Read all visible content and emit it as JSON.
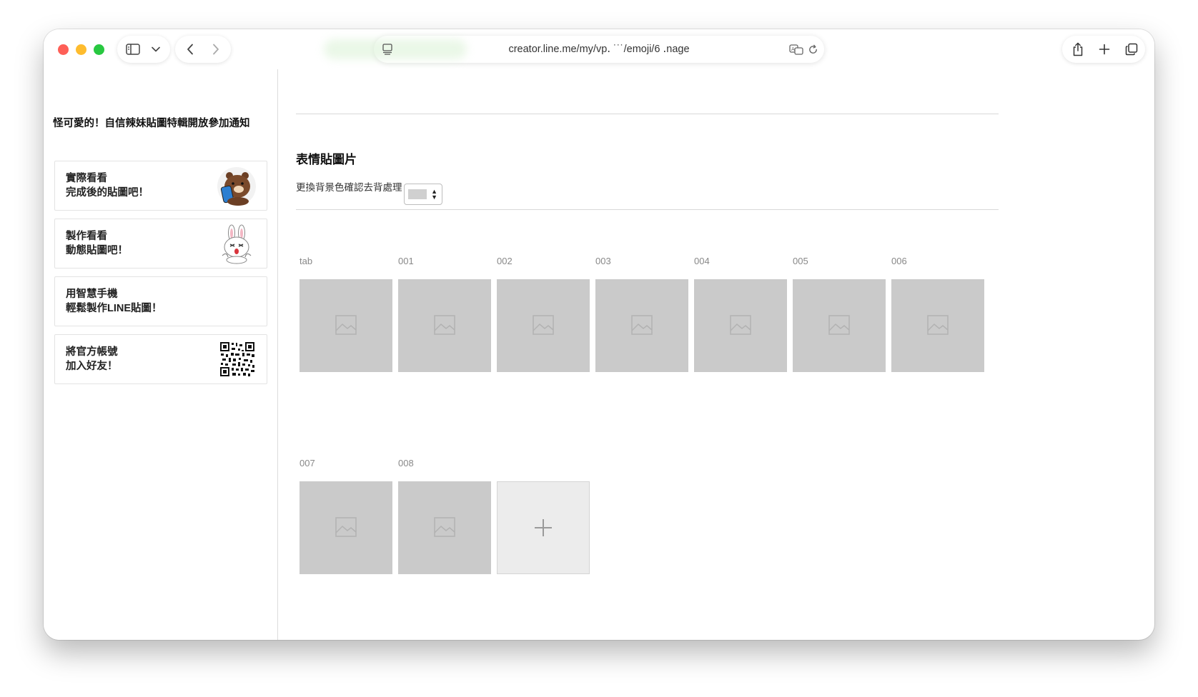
{
  "browser": {
    "url": "creator.line.me/my/vp․       ˙˙˙/emoji/6       ․nage"
  },
  "sidebar": {
    "title": "怪可愛的！自信辣妹貼圖特輯開放參加通知",
    "cards": [
      {
        "line1": "實際看看",
        "line2": "完成後的貼圖吧！",
        "icon": "brown-bear-phone-icon"
      },
      {
        "line1": "製作看看",
        "line2": "動態貼圖吧！",
        "icon": "cony-rabbit-icon"
      },
      {
        "line1": "用智慧手機",
        "line2": "輕鬆製作LINE貼圖！",
        "icon": ""
      },
      {
        "line1": "將官方帳號",
        "line2": "加入好友！",
        "icon": "qr-code-icon"
      }
    ]
  },
  "main": {
    "section_title": "表情貼圖片",
    "bg_option_label": "更換背景色確認去背處理",
    "bg_color": "#d0d0d0",
    "slots": [
      "tab",
      "001",
      "002",
      "003",
      "004",
      "005",
      "006",
      "007",
      "008"
    ]
  },
  "colors": {
    "tile_empty": "#cacaca",
    "tile_add": "#ececec",
    "traffic_red": "#fe5f57",
    "traffic_yellow": "#febc2e",
    "traffic_green": "#28c840"
  }
}
